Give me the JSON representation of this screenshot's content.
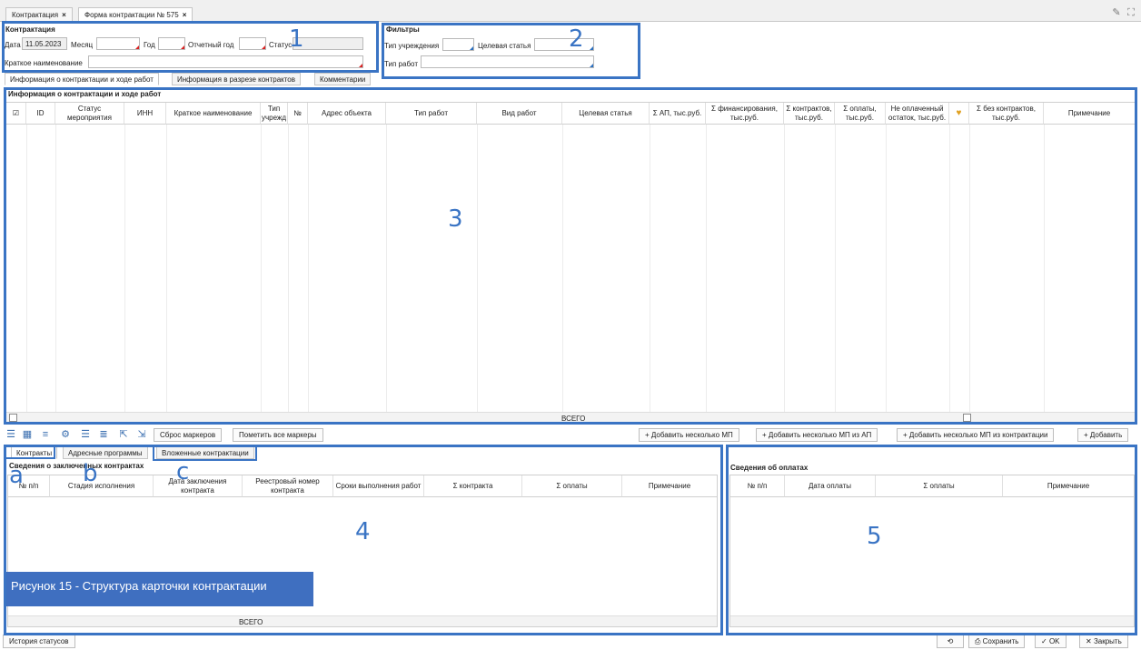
{
  "tabs": [
    {
      "label": "Контрактация"
    },
    {
      "label": "Форма контрактации № 575"
    }
  ],
  "contracting": {
    "title": "Контрактация",
    "date_label": "Дата",
    "date_value": "11.05.2023",
    "month_label": "Месяц",
    "year_label": "Год",
    "report_year_label": "Отчетный год",
    "status_label": "Статус",
    "short_name_label": "Краткое наименование"
  },
  "filters": {
    "title": "Фильтры",
    "org_type_label": "Тип учреждения",
    "target_label": "Целевая статья",
    "work_type_label": "Тип работ"
  },
  "subtabs": [
    "Информация о контрактации и ходе работ",
    "Информация в разрезе контрактов",
    "Комментарии"
  ],
  "main_grid": {
    "title": "Информация о контрактации и ходе работ",
    "columns": [
      "ID",
      "Статус мероприятия",
      "ИНН",
      "Краткое наименование",
      "Тип учрежд",
      "№",
      "Адрес объекта",
      "Тип работ",
      "Вид работ",
      "Целевая статья",
      "Σ АП, тыс.руб.",
      "Σ финансирования, тыс.руб.",
      "Σ контрактов, тыс.руб.",
      "Σ оплаты, тыс.руб.",
      "Не оплаченный остаток, тыс.руб.",
      "Σ без контрактов, тыс.руб.",
      "Примечание"
    ],
    "total_label": "ВСЕГО"
  },
  "toolbar": {
    "reset_markers": "Сброс маркеров",
    "mark_all": "Пометить все маркеры",
    "add_several": "Добавить несколько МП",
    "add_from_ap": "Добавить несколько МП из АП",
    "add_from_contracting": "Добавить несколько МП из контрактации",
    "add": "Добавить"
  },
  "bottom_tabs": [
    "Контракты",
    "Адресные программы",
    "Вложенные контрактации"
  ],
  "contracts": {
    "title": "Сведения о заключенных контрактах",
    "columns": [
      "№ п/п",
      "Стадия исполнения",
      "Дата заключения контракта",
      "Реестровый номер контракта",
      "Сроки выполнения работ",
      "Σ контракта",
      "Σ оплаты",
      "Примечание"
    ],
    "total_label": "ВСЕГО"
  },
  "payments": {
    "title": "Сведения об оплатах",
    "columns": [
      "№ п/п",
      "Дата оплаты",
      "Σ оплаты",
      "Примечание"
    ]
  },
  "caption": "Рисунок 15 - Структура карточки контрактации",
  "annotations": {
    "n1": "1",
    "n2": "2",
    "n3": "3",
    "n4": "4",
    "n5": "5",
    "a": "a",
    "b": "b",
    "c": "c"
  },
  "footer": {
    "history": "История статусов",
    "save": "Сохранить",
    "ok": "OK",
    "close": "Закрыть"
  },
  "colors": {
    "annotation": "#3a74c4",
    "required_marker": "#d92020",
    "caption_bg": "#3f6fc0"
  },
  "icons": [
    "pencil-icon",
    "expand-icon",
    "refresh-icon",
    "save-icon",
    "check-icon",
    "close-icon",
    "settings-icon",
    "filter-icon",
    "list-icon",
    "export-icon",
    "heart-icon"
  ]
}
